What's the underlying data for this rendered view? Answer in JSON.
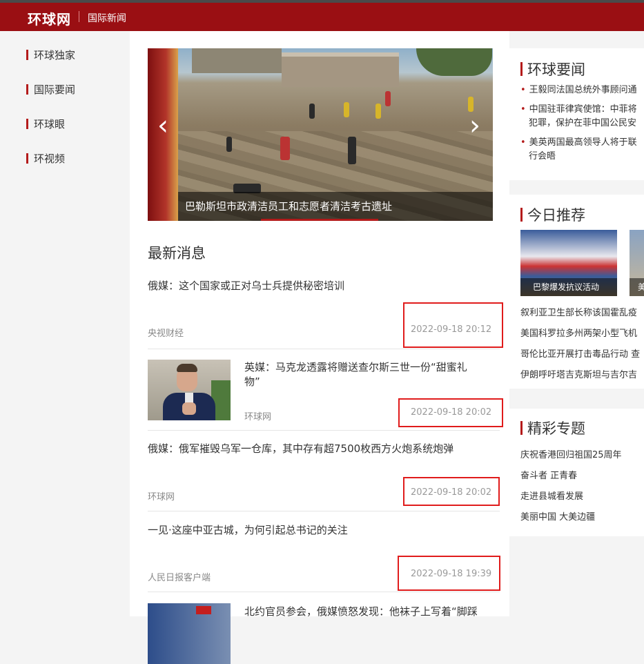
{
  "header": {
    "logo": "环球网",
    "section": "国际新闻"
  },
  "left_nav": {
    "items": [
      "环球独家",
      "国际要闻",
      "环球眼",
      "环视频"
    ]
  },
  "slider": {
    "caption": "巴勒斯坦市政清洁员工和志愿者清洁考古遗址",
    "prev_glyph": "‹",
    "next_glyph": "›"
  },
  "latest": {
    "heading": "最新消息",
    "items": [
      {
        "title": "俄媒：这个国家或正对乌士兵提供秘密培训",
        "source": "央视财经",
        "time": "2022-09-18 20:12"
      },
      {
        "title_line1": "英媒：马克龙透露将赠送查尔斯三世一份“甜蜜礼",
        "title_line2": "物”",
        "source": "环球网",
        "time": "2022-09-18 20:02"
      },
      {
        "title": "俄媒：俄军摧毁乌军一仓库，其中存有超7500枚西方火炮系统炮弹",
        "source": "环球网",
        "time": "2022-09-18 20:02"
      },
      {
        "title": "一见·这座中亚古城，为何引起总书记的关注",
        "source": "人民日报客户端",
        "time": "2022-09-18 19:39"
      },
      {
        "title": "北约官员参会，俄媒愤怒发现：他袜子上写着“脚踩"
      }
    ]
  },
  "global_news": {
    "title": "环球要闻",
    "items": [
      "王毅同法国总统外事顾问通",
      "中国驻菲律宾使馆：中菲将",
      "犯罪，保护在菲中国公民安",
      "美英两国最高领导人将于联",
      "行会晤"
    ]
  },
  "recommend": {
    "title": "今日推荐",
    "image_caption": "巴黎爆发抗议活动",
    "image2_caption": "美",
    "items": [
      "叙利亚卫生部长称该国霍乱疫",
      "美国科罗拉多州两架小型飞机",
      "哥伦比亚开展打击毒品行动 查",
      "伊朗呼吁塔吉克斯坦与吉尔吉"
    ]
  },
  "topics": {
    "title": "精彩专题",
    "items": [
      "庆祝香港回归祖国25周年",
      "奋斗者 正青春",
      "走进县城看发展",
      "美丽中国 大美边疆"
    ]
  },
  "colors": {
    "brand_red": "#9a0f13",
    "accent_red": "#b41b1b",
    "highlight_box": "#e01b1b"
  }
}
